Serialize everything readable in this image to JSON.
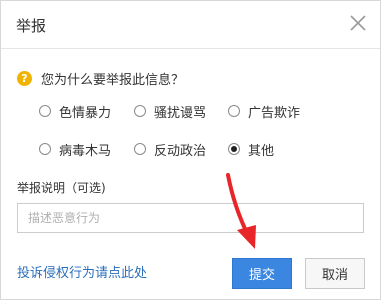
{
  "dialog": {
    "title": "举报",
    "close_icon": "close-icon"
  },
  "question": {
    "icon": "question-icon",
    "icon_glyph": "?",
    "text": "您为什么要举报此信息？"
  },
  "options": [
    {
      "label": "色情暴力",
      "checked": false
    },
    {
      "label": "骚扰谩骂",
      "checked": false
    },
    {
      "label": "广告欺诈",
      "checked": false
    },
    {
      "label": "病毒木马",
      "checked": false
    },
    {
      "label": "反动政治",
      "checked": false
    },
    {
      "label": "其他",
      "checked": true
    }
  ],
  "description": {
    "label": "举报说明（可选)",
    "placeholder": "描述恶意行为",
    "value": ""
  },
  "footer": {
    "complaint_link": "投诉侵权行为请点此处",
    "submit_label": "提交",
    "cancel_label": "取消"
  },
  "colors": {
    "primary": "#3a86e0",
    "link": "#2a6fbe",
    "annotation_arrow": "#e8262a",
    "question_icon": "#f0b400"
  }
}
